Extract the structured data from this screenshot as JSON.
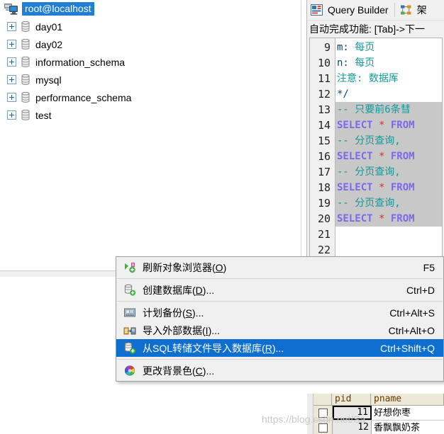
{
  "tree": {
    "root": {
      "label": "root@localhost",
      "icon": "server-icon",
      "selected": true
    },
    "nodes": [
      {
        "label": "day01",
        "icon": "database-icon"
      },
      {
        "label": "day02",
        "icon": "database-icon"
      },
      {
        "label": "information_schema",
        "icon": "database-icon"
      },
      {
        "label": "mysql",
        "icon": "database-icon"
      },
      {
        "label": "performance_schema",
        "icon": "database-icon"
      },
      {
        "label": "test",
        "icon": "database-icon"
      }
    ]
  },
  "editor": {
    "tabs": [
      {
        "label": "Query Builder",
        "icon": "query-builder-icon",
        "active": true
      },
      {
        "label": "架",
        "icon": "schema-icon",
        "active": false
      }
    ],
    "autocomplete_hint": "自动完成功能: [Tab]->下一",
    "line_numbers": [
      "9",
      "10",
      "11",
      "12",
      "13",
      "14",
      "15",
      "16",
      "17",
      "18",
      "19",
      "20",
      "21",
      "22"
    ],
    "lines": [
      {
        "n": "9",
        "selected": false,
        "segments": [
          {
            "t": "          m:  ",
            "k": "plain"
          },
          {
            "t": "每页",
            "k": "comment"
          }
        ]
      },
      {
        "n": "10",
        "selected": false,
        "segments": [
          {
            "t": "          n:  ",
            "k": "plain"
          },
          {
            "t": "每页",
            "k": "comment"
          }
        ]
      },
      {
        "n": "11",
        "selected": false,
        "segments": [
          {
            "t": "   注意:  数据厍",
            "k": "comment"
          }
        ]
      },
      {
        "n": "12",
        "selected": false,
        "segments": [
          {
            "t": "*/",
            "k": "plain"
          }
        ]
      },
      {
        "n": "13",
        "selected": true,
        "segments": [
          {
            "t": "--  只要前6条彗",
            "k": "comment"
          }
        ]
      },
      {
        "n": "14",
        "selected": true,
        "segments": [
          {
            "t": "SELECT ",
            "k": "kw"
          },
          {
            "t": "* ",
            "k": "star"
          },
          {
            "t": " FROM",
            "k": "kw"
          }
        ]
      },
      {
        "n": "15",
        "selected": true,
        "segments": [
          {
            "t": "--  分页查询,",
            "k": "comment"
          }
        ]
      },
      {
        "n": "16",
        "selected": true,
        "segments": [
          {
            "t": "SELECT ",
            "k": "kw"
          },
          {
            "t": "* ",
            "k": "star"
          },
          {
            "t": " FROM",
            "k": "kw"
          }
        ]
      },
      {
        "n": "17",
        "selected": true,
        "segments": [
          {
            "t": "--  分页查询,",
            "k": "comment"
          }
        ]
      },
      {
        "n": "18",
        "selected": true,
        "segments": [
          {
            "t": "SELECT ",
            "k": "kw"
          },
          {
            "t": "* ",
            "k": "star"
          },
          {
            "t": " FROM",
            "k": "kw"
          }
        ]
      },
      {
        "n": "19",
        "selected": true,
        "segments": [
          {
            "t": "--  分页查询,",
            "k": "comment"
          }
        ]
      },
      {
        "n": "20",
        "selected": true,
        "segments": [
          {
            "t": "SELECT ",
            "k": "kw"
          },
          {
            "t": "* ",
            "k": "star"
          },
          {
            "t": " FROM",
            "k": "kw"
          }
        ]
      },
      {
        "n": "21",
        "selected": false,
        "segments": []
      },
      {
        "n": "22",
        "selected": false,
        "segments": []
      }
    ]
  },
  "context_menu": {
    "accent_color": "#0e6fd0",
    "items": [
      {
        "icon": "refresh-icon",
        "label_pre": "刷新对象浏览器(",
        "mnemonic": "O",
        "label_post": ")",
        "shortcut": "F5",
        "selected": false,
        "separator_after": true
      },
      {
        "icon": "create-database-icon",
        "label_pre": "创建数据库(",
        "mnemonic": "D",
        "label_post": ")...",
        "shortcut": "Ctrl+D",
        "selected": false,
        "separator_after": true
      },
      {
        "icon": "backup-icon",
        "label_pre": "计划备份(",
        "mnemonic": "S",
        "label_post": ")...",
        "shortcut": "Ctrl+Alt+S",
        "selected": false,
        "separator_after": false
      },
      {
        "icon": "import-data-icon",
        "label_pre": "导入外部数据(",
        "mnemonic": "I",
        "label_post": ")...",
        "shortcut": "Ctrl+Alt+O",
        "selected": false,
        "separator_after": false
      },
      {
        "icon": "import-sql-icon",
        "label_pre": "从SQL转储文件导入数据库(",
        "mnemonic": "R",
        "label_post": ")...",
        "shortcut": "Ctrl+Shift+Q",
        "selected": true,
        "separator_after": true
      },
      {
        "icon": "color-wheel-icon",
        "label_pre": "更改背景色(",
        "mnemonic": "C",
        "label_post": ")...",
        "shortcut": "",
        "selected": false,
        "separator_after": false
      }
    ]
  },
  "result_grid": {
    "columns": [
      "pid",
      "pname"
    ],
    "rows": [
      {
        "pid": "11",
        "pname": "好想你枣",
        "current": true
      },
      {
        "pid": "12",
        "pname": "香飘飘奶茶",
        "current": false
      }
    ]
  },
  "watermark": {
    "text": "https://blog.csdn.net/Sa"
  }
}
